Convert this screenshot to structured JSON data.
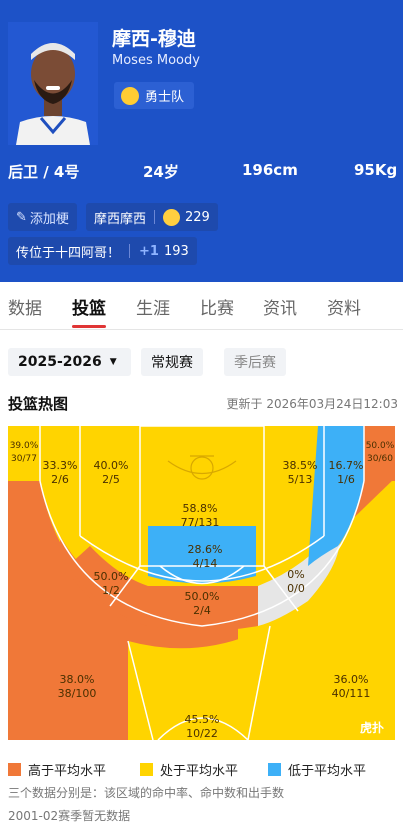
{
  "player": {
    "name_cn": "摩西-穆迪",
    "name_en": "Moses Moody",
    "team": "勇士队",
    "position": "后卫 / 4号",
    "age": "24岁",
    "height": "196cm",
    "weight": "95Kg"
  },
  "tags": {
    "add_tag": "添加梗",
    "nickname": "摩西摩西",
    "nickname_count": "229",
    "quote": "传位于十四阿哥！",
    "quote_plus": "+1",
    "quote_count": "193"
  },
  "tabs": [
    "数据",
    "投篮",
    "生涯",
    "比赛",
    "资讯",
    "资料"
  ],
  "filters": {
    "season": "2025-2026",
    "regular": "常规赛",
    "playoffs": "季后赛"
  },
  "heatmap": {
    "title": "投篮热图",
    "updated": "更新于 2026年03月24日12:03",
    "watermark": "虎扑",
    "zones": {
      "corner_left_pct": "39.0%",
      "corner_left_made": "30/77",
      "corner_right_pct": "50.0%",
      "corner_right_made": "30/60",
      "mid_left_base_pct": "33.3%",
      "mid_left_base_made": "2/6",
      "mid_left_elbow_pct": "40.0%",
      "mid_left_elbow_made": "2/5",
      "mid_right_elbow_pct": "38.5%",
      "mid_right_elbow_made": "5/13",
      "mid_right_base_pct": "16.7%",
      "mid_right_base_made": "1/6",
      "rim_pct": "58.8%",
      "rim_made": "77/131",
      "paint_pct": "28.6%",
      "paint_made": "4/14",
      "mid_left_wing_pct": "50.0%",
      "mid_left_wing_made": "1/2",
      "mid_top_pct": "50.0%",
      "mid_top_made": "2/4",
      "mid_right_wing_pct": "0%",
      "mid_right_wing_made": "0/0",
      "three_left_pct": "38.0%",
      "three_left_made": "38/100",
      "three_top_pct": "45.5%",
      "three_top_made": "10/22",
      "three_right_pct": "36.0%",
      "three_right_made": "40/111"
    }
  },
  "legend": {
    "above": "高于平均水平",
    "average": "处于平均水平",
    "below": "低于平均水平",
    "colors": {
      "above": "#f07838",
      "average": "#ffd400",
      "below": "#3db0f7",
      "none": "#e6e6e6"
    }
  },
  "notes": {
    "line1": "三个数据分别是：该区域的命中率、命中数和出手数",
    "line2": "2001-02赛季暂无数据"
  }
}
